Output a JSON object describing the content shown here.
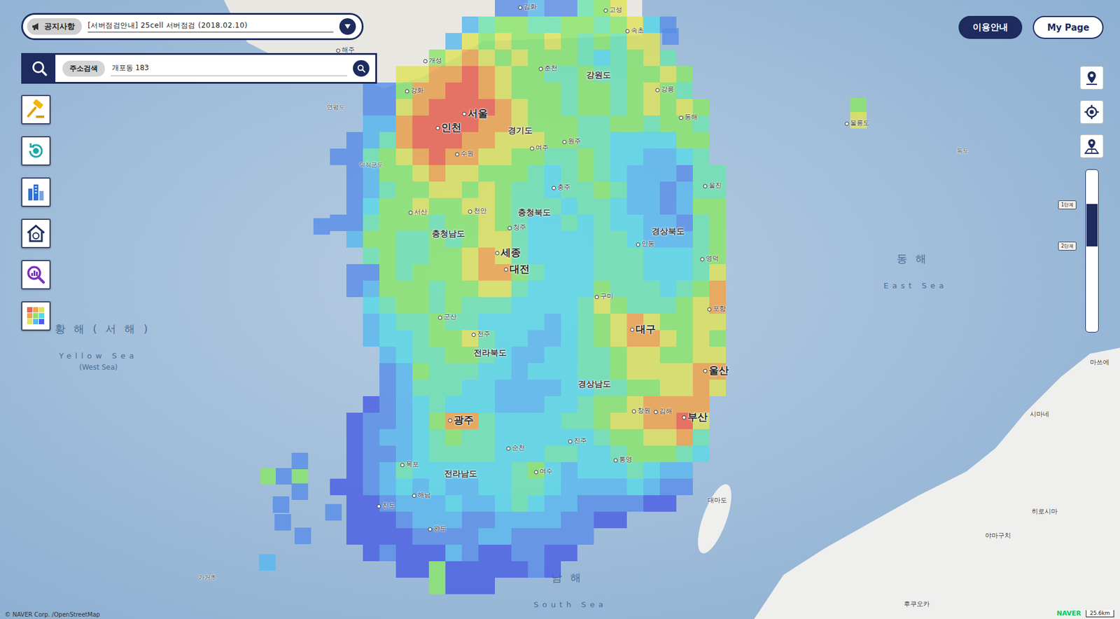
{
  "notice": {
    "label": "공지사항",
    "text": "[서버점검안내] 25cell 서버점검 (2018.02.10)"
  },
  "search": {
    "label": "주소검색",
    "value": "개포동 183"
  },
  "header_buttons": [
    {
      "label": "이용안내",
      "kind": "primary"
    },
    {
      "label": "My Page",
      "kind": "secondary"
    }
  ],
  "zoom": {
    "level": 0.21,
    "steps": [
      {
        "label": "1단계"
      },
      {
        "label": "2단계"
      }
    ]
  },
  "map": {
    "labels": [
      {
        "text": "서울",
        "kind": "metro"
      },
      {
        "text": "인천",
        "kind": "metro"
      },
      {
        "text": "세종",
        "kind": "metro"
      },
      {
        "text": "대전",
        "kind": "metro"
      },
      {
        "text": "대구",
        "kind": "metro"
      },
      {
        "text": "울산",
        "kind": "metro"
      },
      {
        "text": "부산",
        "kind": "metro"
      },
      {
        "text": "광주",
        "kind": "metro"
      },
      {
        "text": "경기도",
        "kind": "region"
      },
      {
        "text": "강원도",
        "kind": "region"
      },
      {
        "text": "충청북도",
        "kind": "region"
      },
      {
        "text": "충청남도",
        "kind": "region"
      },
      {
        "text": "경상북도",
        "kind": "region"
      },
      {
        "text": "경상남도",
        "kind": "region"
      },
      {
        "text": "전라북도",
        "kind": "region"
      },
      {
        "text": "전라남도",
        "kind": "region"
      },
      {
        "text": "동해",
        "kind": "sea"
      },
      {
        "text": "East Sea",
        "kind": "sea-en"
      },
      {
        "text": "황해(서해)",
        "kind": "sea"
      },
      {
        "text": "Yellow Sea",
        "kind": "sea-en"
      },
      {
        "text": "(West Sea)",
        "kind": "sea-sub"
      },
      {
        "text": "남해",
        "kind": "sea"
      },
      {
        "text": "South Sea",
        "kind": "sea-en"
      },
      {
        "text": "울릉도",
        "kind": "city"
      },
      {
        "text": "독도",
        "kind": "minor"
      },
      {
        "text": "대마도",
        "kind": "foreign"
      },
      {
        "text": "시마네",
        "kind": "foreign"
      },
      {
        "text": "히로시마",
        "kind": "foreign"
      },
      {
        "text": "야마구치",
        "kind": "foreign"
      },
      {
        "text": "후쿠오카",
        "kind": "foreign"
      },
      {
        "text": "마쓰에",
        "kind": "foreign"
      },
      {
        "text": "가거초",
        "kind": "minor"
      },
      {
        "text": "개성",
        "kind": "city"
      },
      {
        "text": "해주",
        "kind": "city"
      },
      {
        "text": "강화",
        "kind": "city"
      },
      {
        "text": "연평도",
        "kind": "minor"
      },
      {
        "text": "덕적군도",
        "kind": "minor"
      },
      {
        "text": "춘천",
        "kind": "city"
      },
      {
        "text": "강릉",
        "kind": "city"
      },
      {
        "text": "원주",
        "kind": "city"
      },
      {
        "text": "수원",
        "kind": "city"
      },
      {
        "text": "여주",
        "kind": "city"
      },
      {
        "text": "청주",
        "kind": "city"
      },
      {
        "text": "충주",
        "kind": "city"
      },
      {
        "text": "서산",
        "kind": "city"
      },
      {
        "text": "천안",
        "kind": "city"
      },
      {
        "text": "포항",
        "kind": "city"
      },
      {
        "text": "안동",
        "kind": "city"
      },
      {
        "text": "구미",
        "kind": "city"
      },
      {
        "text": "전주",
        "kind": "city"
      },
      {
        "text": "군산",
        "kind": "city"
      },
      {
        "text": "목포",
        "kind": "city"
      },
      {
        "text": "여수",
        "kind": "city"
      },
      {
        "text": "순천",
        "kind": "city"
      },
      {
        "text": "진주",
        "kind": "city"
      },
      {
        "text": "창원",
        "kind": "city"
      },
      {
        "text": "김해",
        "kind": "city"
      },
      {
        "text": "통영",
        "kind": "city"
      },
      {
        "text": "진도",
        "kind": "city"
      },
      {
        "text": "완도",
        "kind": "city"
      },
      {
        "text": "해남",
        "kind": "city"
      },
      {
        "text": "영덕",
        "kind": "city"
      },
      {
        "text": "울진",
        "kind": "city"
      },
      {
        "text": "동해",
        "kind": "city"
      },
      {
        "text": "속초",
        "kind": "city"
      },
      {
        "text": "김화",
        "kind": "city"
      },
      {
        "text": "고성",
        "kind": "city"
      }
    ],
    "heat_rows": [
      [
        0,
        0,
        0,
        0,
        0,
        0,
        0,
        0,
        0,
        0,
        2,
        2,
        3,
        2,
        2,
        5,
        6,
        7
      ],
      [
        0,
        0,
        0,
        0,
        0,
        0,
        0,
        0,
        3,
        5,
        6,
        6,
        5,
        5,
        6,
        6,
        5,
        6,
        7,
        4,
        2
      ],
      [
        0,
        0,
        0,
        0,
        0,
        0,
        0,
        3,
        7,
        6,
        7,
        6,
        6,
        7,
        6,
        5,
        6,
        5,
        7,
        7
      ],
      [
        0,
        0,
        0,
        0,
        0,
        0,
        6,
        7,
        8,
        7,
        6,
        7,
        6,
        6,
        6,
        5,
        4,
        5,
        6,
        7,
        5
      ],
      [
        0,
        0,
        0,
        0,
        7,
        7,
        8,
        8,
        9,
        8,
        7,
        6,
        6,
        5,
        5,
        6,
        5,
        5,
        6,
        6,
        7,
        6
      ],
      [
        0,
        0,
        2,
        2,
        6,
        8,
        8,
        9,
        9,
        8,
        7,
        6,
        6,
        6,
        5,
        6,
        6,
        5,
        6,
        7,
        6,
        5
      ],
      [
        0,
        0,
        2,
        2,
        7,
        8,
        9,
        9,
        9,
        9,
        8,
        7,
        6,
        6,
        5,
        6,
        6,
        5,
        6,
        7,
        6,
        7,
        6
      ],
      [
        0,
        0,
        3,
        3,
        8,
        9,
        9,
        9,
        9,
        8,
        8,
        7,
        6,
        6,
        6,
        5,
        5,
        6,
        6,
        5,
        6,
        6,
        5
      ],
      [
        0,
        2,
        3,
        5,
        8,
        9,
        9,
        9,
        8,
        8,
        7,
        7,
        7,
        6,
        6,
        5,
        5,
        4,
        4,
        4,
        4,
        6,
        6
      ],
      [
        2,
        2,
        5,
        6,
        7,
        8,
        9,
        8,
        8,
        7,
        7,
        6,
        6,
        5,
        5,
        6,
        5,
        4,
        4,
        3,
        3,
        4,
        5
      ],
      [
        0,
        2,
        3,
        6,
        6,
        7,
        8,
        7,
        7,
        6,
        6,
        6,
        5,
        4,
        5,
        6,
        5,
        4,
        3,
        3,
        3,
        2,
        5,
        5
      ],
      [
        0,
        2,
        3,
        5,
        6,
        6,
        7,
        7,
        6,
        7,
        6,
        5,
        5,
        4,
        5,
        5,
        6,
        5,
        3,
        3,
        2,
        3,
        5,
        5
      ],
      [
        0,
        2,
        4,
        6,
        6,
        7,
        6,
        6,
        7,
        7,
        6,
        5,
        5,
        5,
        4,
        5,
        5,
        4,
        3,
        3,
        2,
        3,
        6,
        6
      ],
      [
        2,
        2,
        5,
        6,
        6,
        6,
        5,
        6,
        6,
        7,
        6,
        5,
        4,
        4,
        5,
        4,
        5,
        4,
        4,
        3,
        3,
        2,
        5,
        6
      ],
      [
        0,
        3,
        6,
        6,
        5,
        5,
        6,
        5,
        6,
        7,
        7,
        5,
        4,
        4,
        4,
        4,
        5,
        5,
        4,
        3,
        3,
        3,
        5,
        6
      ],
      [
        0,
        0,
        5,
        6,
        5,
        5,
        6,
        6,
        7,
        8,
        7,
        5,
        4,
        4,
        4,
        4,
        5,
        5,
        5,
        4,
        4,
        4,
        5,
        6
      ],
      [
        0,
        2,
        2,
        6,
        5,
        6,
        6,
        6,
        7,
        8,
        8,
        6,
        5,
        4,
        4,
        4,
        5,
        5,
        5,
        4,
        4,
        4,
        5,
        7
      ],
      [
        0,
        2,
        3,
        6,
        6,
        6,
        5,
        6,
        6,
        7,
        7,
        5,
        4,
        4,
        4,
        4,
        6,
        5,
        5,
        5,
        4,
        5,
        6,
        8
      ],
      [
        0,
        0,
        4,
        5,
        6,
        6,
        5,
        6,
        5,
        5,
        5,
        4,
        4,
        4,
        4,
        5,
        7,
        6,
        5,
        5,
        5,
        6,
        7,
        8
      ],
      [
        0,
        0,
        3,
        4,
        5,
        5,
        6,
        5,
        5,
        4,
        4,
        4,
        4,
        3,
        4,
        5,
        6,
        7,
        8,
        7,
        6,
        6,
        7,
        7
      ],
      [
        0,
        0,
        3,
        4,
        4,
        5,
        6,
        6,
        7,
        5,
        4,
        4,
        3,
        3,
        4,
        5,
        6,
        7,
        8,
        8,
        7,
        6,
        7,
        6
      ],
      [
        0,
        0,
        0,
        3,
        4,
        5,
        5,
        6,
        6,
        5,
        4,
        3,
        3,
        4,
        4,
        5,
        5,
        6,
        7,
        7,
        6,
        6,
        7,
        7
      ],
      [
        0,
        0,
        0,
        2,
        3,
        6,
        5,
        5,
        5,
        4,
        4,
        3,
        4,
        4,
        4,
        5,
        5,
        6,
        7,
        7,
        7,
        7,
        8,
        8
      ],
      [
        0,
        0,
        0,
        2,
        3,
        5,
        5,
        5,
        4,
        4,
        3,
        3,
        3,
        3,
        4,
        4,
        5,
        5,
        6,
        6,
        7,
        7,
        8,
        7
      ],
      [
        0,
        0,
        1,
        2,
        3,
        4,
        5,
        4,
        4,
        4,
        3,
        3,
        3,
        4,
        4,
        5,
        6,
        6,
        7,
        8,
        8,
        8,
        8
      ],
      [
        0,
        1,
        2,
        2,
        3,
        4,
        6,
        8,
        8,
        5,
        4,
        4,
        4,
        4,
        5,
        5,
        6,
        7,
        7,
        8,
        8,
        9,
        7
      ],
      [
        0,
        1,
        2,
        3,
        3,
        4,
        5,
        6,
        5,
        5,
        4,
        4,
        4,
        4,
        4,
        4,
        5,
        6,
        6,
        7,
        7,
        8,
        5
      ],
      [
        0,
        1,
        2,
        2,
        3,
        4,
        5,
        5,
        5,
        5,
        4,
        4,
        4,
        5,
        5,
        4,
        4,
        5,
        6,
        6,
        6,
        5,
        4
      ],
      [
        0,
        1,
        2,
        3,
        5,
        4,
        4,
        4,
        4,
        4,
        4,
        5,
        6,
        4,
        3,
        4,
        4,
        4,
        5,
        4,
        3,
        3
      ],
      [
        1,
        1,
        2,
        3,
        4,
        3,
        4,
        3,
        3,
        4,
        4,
        5,
        5,
        4,
        3,
        3,
        3,
        3,
        4,
        3,
        2,
        2
      ],
      [
        0,
        1,
        1,
        2,
        3,
        3,
        3,
        4,
        3,
        3,
        4,
        5,
        4,
        3,
        3,
        2,
        2,
        2,
        2,
        1,
        1
      ],
      [
        0,
        1,
        1,
        1,
        2,
        3,
        3,
        3,
        2,
        2,
        3,
        3,
        3,
        3,
        2,
        2,
        1,
        1
      ],
      [
        0,
        1,
        1,
        1,
        1,
        2,
        2,
        2,
        2,
        3,
        3,
        2,
        2,
        2,
        2,
        2
      ],
      [
        0,
        0,
        1,
        2,
        1,
        1,
        1,
        3,
        2,
        1,
        1,
        2,
        2,
        1,
        1
      ],
      [
        0,
        0,
        0,
        0,
        1,
        1,
        6,
        1,
        1,
        1,
        1,
        1,
        2,
        1
      ],
      [
        0,
        0,
        0,
        0,
        0,
        0,
        6,
        1,
        1,
        1
      ]
    ],
    "island_cells": [
      6,
      7,
      2,
      2,
      6,
      2,
      6,
      2,
      2,
      2,
      2,
      2,
      3,
      2
    ]
  },
  "attribution": "© NAVER Corp. /OpenStreetMap",
  "logo": "NAVER",
  "scale": "25.6km"
}
